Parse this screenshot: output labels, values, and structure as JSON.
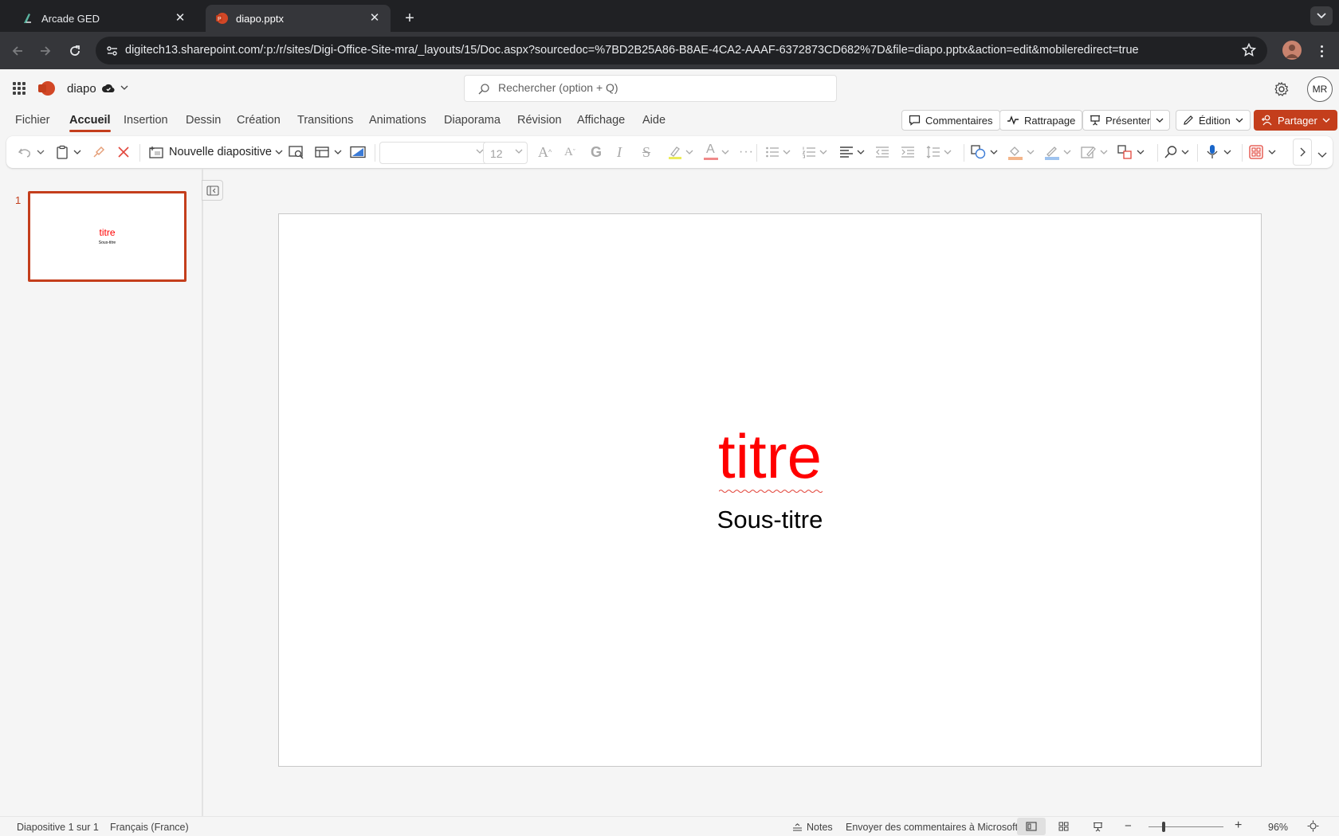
{
  "browser": {
    "tabs": [
      {
        "title": "Arcade GED",
        "active": false
      },
      {
        "title": "diapo.pptx",
        "active": true
      }
    ],
    "url": "digitech13.sharepoint.com/:p:/r/sites/Digi-Office-Site-mra/_layouts/15/Doc.aspx?sourcedoc=%7BD2B25A86-B8AE-4CA2-AAAF-6372873CD682%7D&file=diapo.pptx&action=edit&mobileredirect=true"
  },
  "office": {
    "doc_name": "diapo",
    "search_placeholder": "Rechercher (option + Q)",
    "user_initials": "MR",
    "accent": "#c43e1c"
  },
  "ribbon": {
    "tabs": [
      "Fichier",
      "Accueil",
      "Insertion",
      "Dessin",
      "Création",
      "Transitions",
      "Animations",
      "Diaporama",
      "Révision",
      "Affichage",
      "Aide"
    ],
    "active_tab": "Accueil",
    "buttons": {
      "comments": "Commentaires",
      "catchup": "Rattrapage",
      "present": "Présenter",
      "editing": "Édition",
      "share": "Partager"
    },
    "toolbar": {
      "new_slide": "Nouvelle diapositive",
      "font_name": "",
      "font_size": "12",
      "bold_glyph": "G",
      "italic_glyph": "I",
      "strike_glyph": "S",
      "grow_glyph": "A",
      "shrink_glyph": "A",
      "color_glyph": "A",
      "more": "···"
    }
  },
  "slides": [
    {
      "number": "1",
      "title": "titre",
      "subtitle": "Sous-titre"
    }
  ],
  "slide": {
    "title": "titre",
    "subtitle": "Sous-titre",
    "title_color": "#ff0000"
  },
  "status": {
    "slide_position": "Diapositive 1 sur 1",
    "language": "Français (France)",
    "notes": "Notes",
    "feedback": "Envoyer des commentaires à Microsoft",
    "zoom": "96%"
  }
}
